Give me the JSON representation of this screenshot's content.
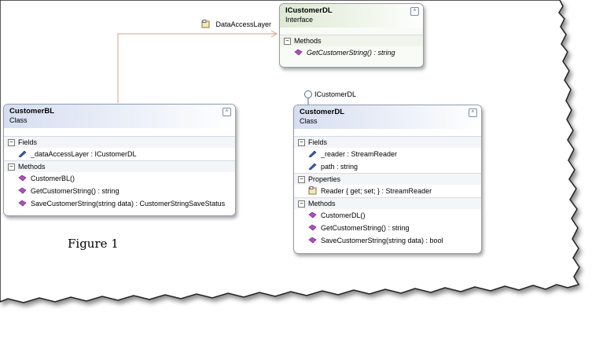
{
  "classes": {
    "icustomerdl": {
      "name": "ICustomerDL",
      "stereotype": "Interface",
      "methods_header": "Methods",
      "methods": [
        "GetCustomerString() : string"
      ]
    },
    "customerbl": {
      "name": "CustomerBL",
      "stereotype": "Class",
      "fields_header": "Fields",
      "fields": [
        "_dataAccessLayer : ICustomerDL"
      ],
      "methods_header": "Methods",
      "methods": [
        "CustomerBL()",
        "GetCustomerString() : string",
        "SaveCustomerString(string data) : CustomerStringSaveStatus"
      ]
    },
    "customerdl": {
      "name": "CustomerDL",
      "stereotype": "Class",
      "fields_header": "Fields",
      "fields": [
        "_reader : StreamReader",
        "path : string"
      ],
      "properties_header": "Properties",
      "properties": [
        "Reader { get; set; } : StreamReader"
      ],
      "methods_header": "Methods",
      "methods": [
        "CustomerDL()",
        "GetCustomerString() : string",
        "SaveCustomerString(string data) : bool"
      ]
    }
  },
  "association_label": "DataAccessLayer",
  "lollipop_label": "ICustomerDL",
  "caption": "Figure 1",
  "colors": {
    "association_line": "#d4a086",
    "class_border": "#8f9fb4",
    "method_icon": "#b04fc0",
    "field_icon": "#3a5fb0"
  }
}
